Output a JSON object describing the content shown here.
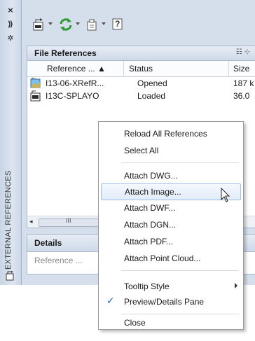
{
  "palette": {
    "title": "EXTERNAL REFERENCES",
    "titlebar_glyphs": {
      "close": "×",
      "autohide": "⟫",
      "properties": "✲"
    }
  },
  "toolbar": {
    "tools": [
      "attach-dwg-icon",
      "refresh-icon",
      "change-path-icon",
      "help-icon"
    ],
    "help_label": "?"
  },
  "file_references": {
    "title": "File References",
    "view_icons": "☷ ⊹",
    "columns": [
      "Reference ... ▲",
      "Status",
      "Size"
    ],
    "rows": [
      {
        "name": "I13-06-XRefR...",
        "status": "Opened",
        "size": "187 k",
        "icon": "image-file-icon"
      },
      {
        "name": "I13C-SPLAYO",
        "status": "Loaded",
        "size": "36.0",
        "icon": "dwg-file-icon"
      }
    ],
    "scroll_left": "◂",
    "scroll_grip": "III"
  },
  "details": {
    "title": "Details",
    "field": "Reference ..."
  },
  "context_menu": {
    "items": [
      {
        "label": "Reload All References"
      },
      {
        "label": "Select All"
      },
      {
        "label": "Attach DWG..."
      },
      {
        "label": "Attach Image..."
      },
      {
        "label": "Attach DWF..."
      },
      {
        "label": "Attach DGN..."
      },
      {
        "label": "Attach PDF..."
      },
      {
        "label": "Attach Point Cloud..."
      },
      {
        "label": "Tooltip Style"
      },
      {
        "label": "Preview/Details Pane"
      },
      {
        "label": "Close"
      }
    ],
    "highlighted_item": "Attach Image...",
    "checked_item": "Preview/Details Pane",
    "check_glyph": "✓"
  },
  "colors": {
    "panel_bg": "#d5dfec",
    "highlight_border": "#9ebfe6",
    "refresh_green": "#2f9a2f",
    "check_blue": "#2b68c9"
  }
}
